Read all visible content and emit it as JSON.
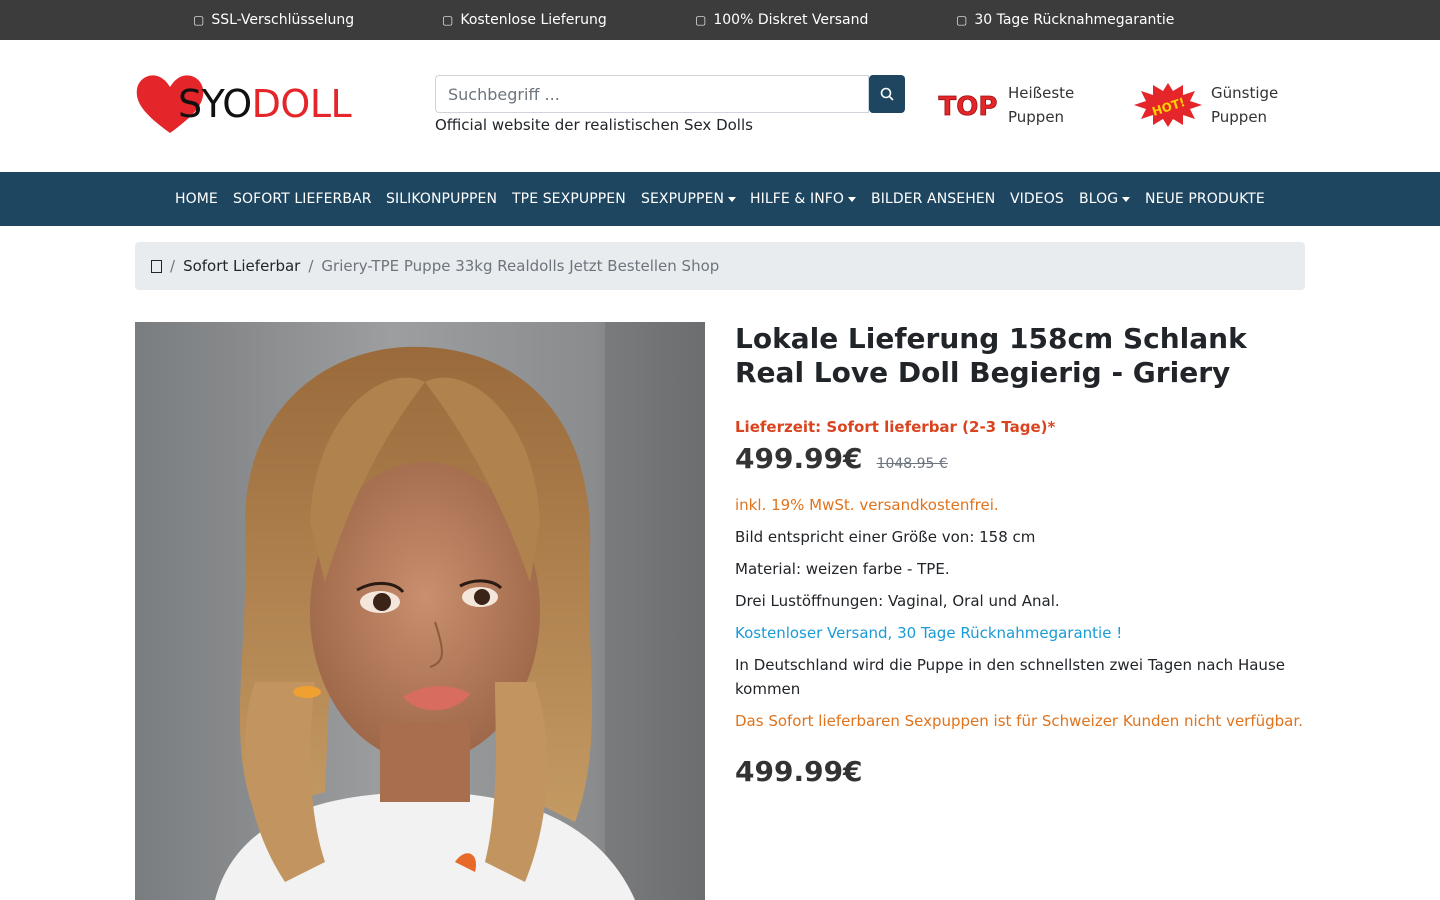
{
  "topbar": {
    "items": [
      {
        "icon": "lock-icon",
        "label": "SSL-Verschlüsselung"
      },
      {
        "icon": "truck-icon",
        "label": "Kostenlose Lieferung"
      },
      {
        "icon": "box-icon",
        "label": "100% Diskret Versand"
      },
      {
        "icon": "return-icon",
        "label": "30 Tage Rücknahmegarantie"
      }
    ]
  },
  "header": {
    "logo": {
      "part1": "SYO",
      "part2": "DOLL"
    },
    "search": {
      "placeholder": "Suchbegriff ...",
      "button_icon": "search-icon"
    },
    "tagline": "Official website der realistischen Sex Dolls",
    "top_badge": {
      "badge": "TOP",
      "line1": "Heißeste",
      "line2": "Puppen"
    },
    "hot_badge": {
      "badge": "HOT!",
      "line1": "Günstige",
      "line2": "Puppen"
    }
  },
  "nav": {
    "items": [
      {
        "label": "HOME"
      },
      {
        "label": "SOFORT LIEFERBAR"
      },
      {
        "label": "SILIKONPUPPEN"
      },
      {
        "label": "TPE SEXPUPPEN"
      },
      {
        "label": "SEXPUPPEN",
        "dropdown": true
      },
      {
        "label": "HILFE & INFO",
        "dropdown": true
      },
      {
        "label": "BILDER ANSEHEN"
      },
      {
        "label": "VIDEOS"
      },
      {
        "label": "BLOG",
        "dropdown": true
      },
      {
        "label": "NEUE PRODUKTE"
      }
    ]
  },
  "breadcrumb": {
    "home_icon": "home-icon",
    "link": "Sofort Lieferbar",
    "current": "Griery-TPE Puppe 33kg Realdolls Jetzt Bestellen Shop"
  },
  "product": {
    "title_line1": "Lokale Lieferung 158cm Schlank",
    "title_line2": "Real Love Doll Begierig - Griery",
    "delivery": "Lieferzeit: Sofort lieferbar (2-3 Tage)*",
    "price": "499.99€",
    "old_price": "1048.95 €",
    "vat": "inkl. 19% MwSt. versandkostenfrei.",
    "size": "Bild entspricht einer Größe von: 158 cm",
    "material": "Material: weizen farbe - TPE.",
    "openings": "Drei Lustöffnungen: Vaginal, Oral und Anal.",
    "shipping": "Kostenloser Versand, 30 Tage Rücknahmegarantie !",
    "germany": "In Deutschland wird die Puppe in den schnellsten zwei Tagen nach Hause kommen",
    "swiss": "Das Sofort lieferbaren Sexpuppen ist für Schweizer Kunden nicht verfügbar.",
    "price_bottom": "499.99€"
  },
  "colors": {
    "topbar_bg": "#3c3c3c",
    "nav_bg": "#1f4660",
    "brand_red": "#e4252a",
    "delivery_red": "#d9441f",
    "info_orange": "#e0731c",
    "info_blue": "#1a9bd7"
  }
}
